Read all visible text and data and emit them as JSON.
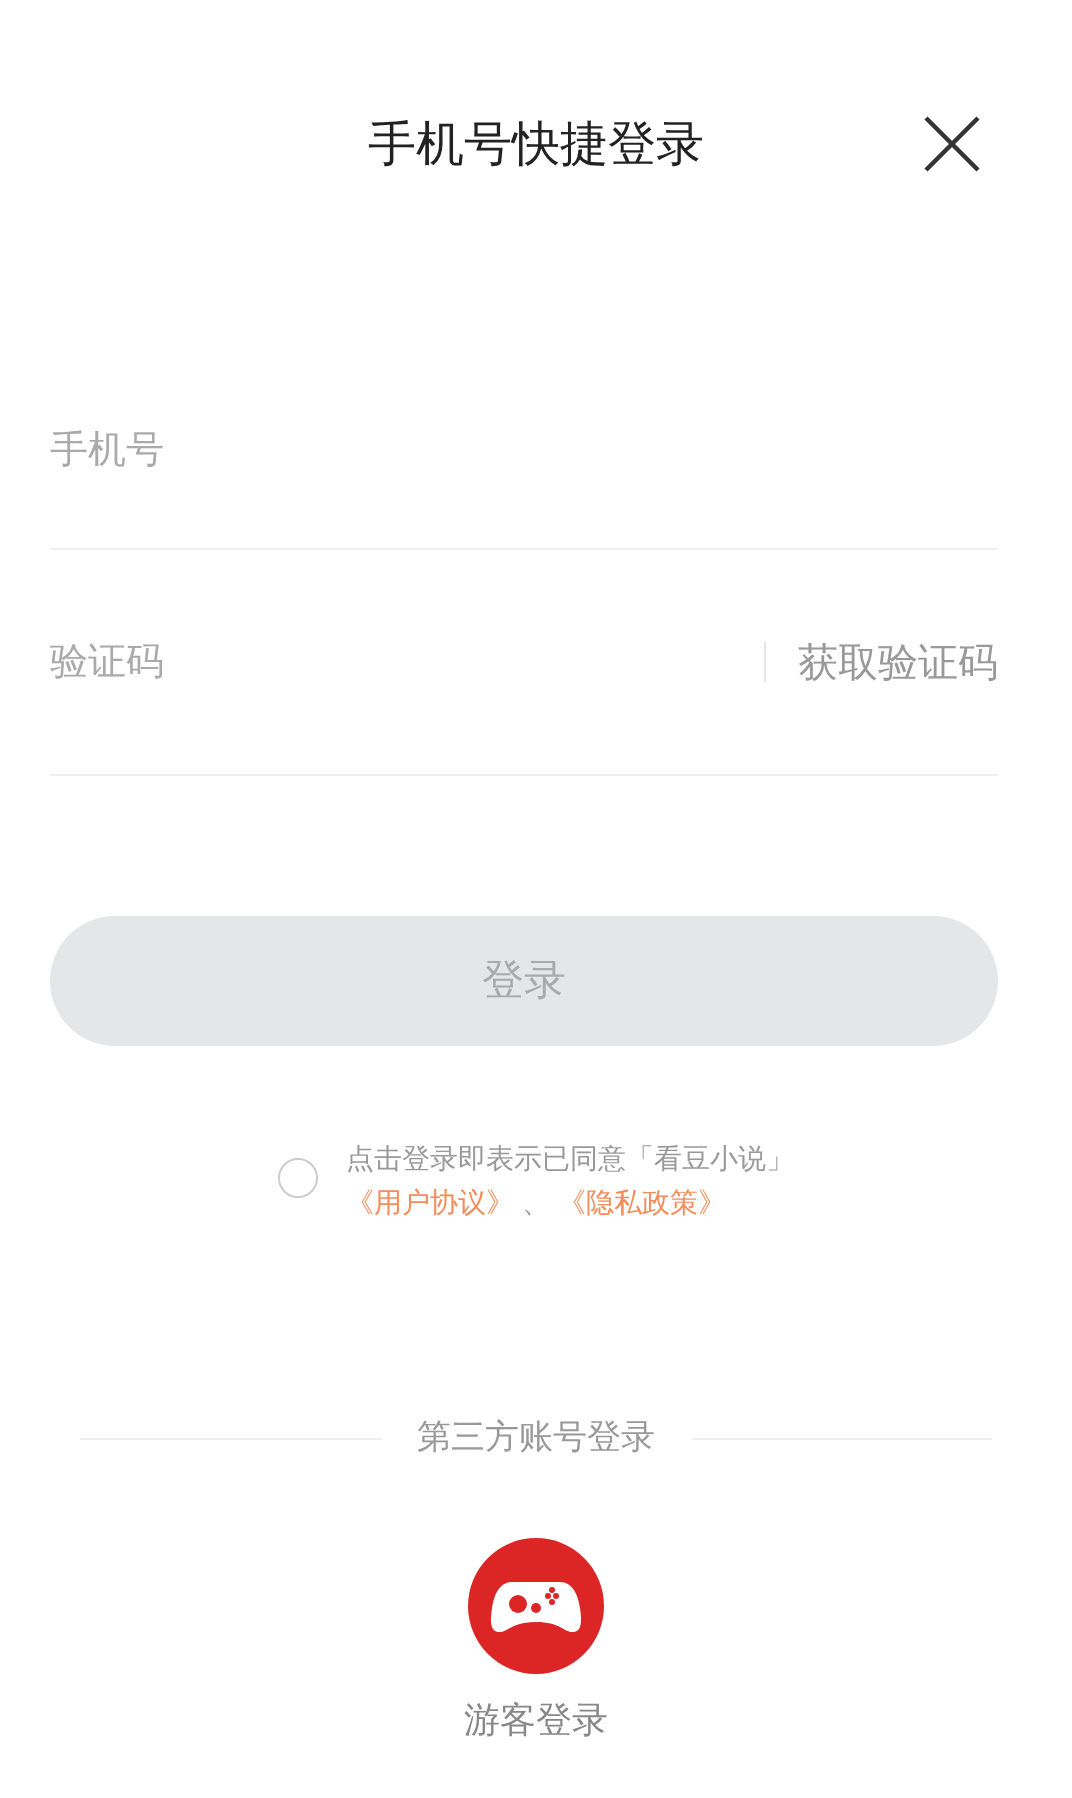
{
  "header": {
    "title": "手机号快捷登录"
  },
  "phone_field": {
    "placeholder": "手机号"
  },
  "code_field": {
    "placeholder": "验证码",
    "action": "获取验证码"
  },
  "login_button": {
    "label": "登录",
    "disabled": true
  },
  "agreement": {
    "checked": false,
    "text": "点击登录即表示已同意「看豆小说」",
    "links": [
      "《用户协议》",
      "《隐私政策》"
    ],
    "separator": "、"
  },
  "third_party": {
    "heading": "第三方账号登录",
    "options": [
      {
        "label": "游客登录"
      }
    ]
  }
}
